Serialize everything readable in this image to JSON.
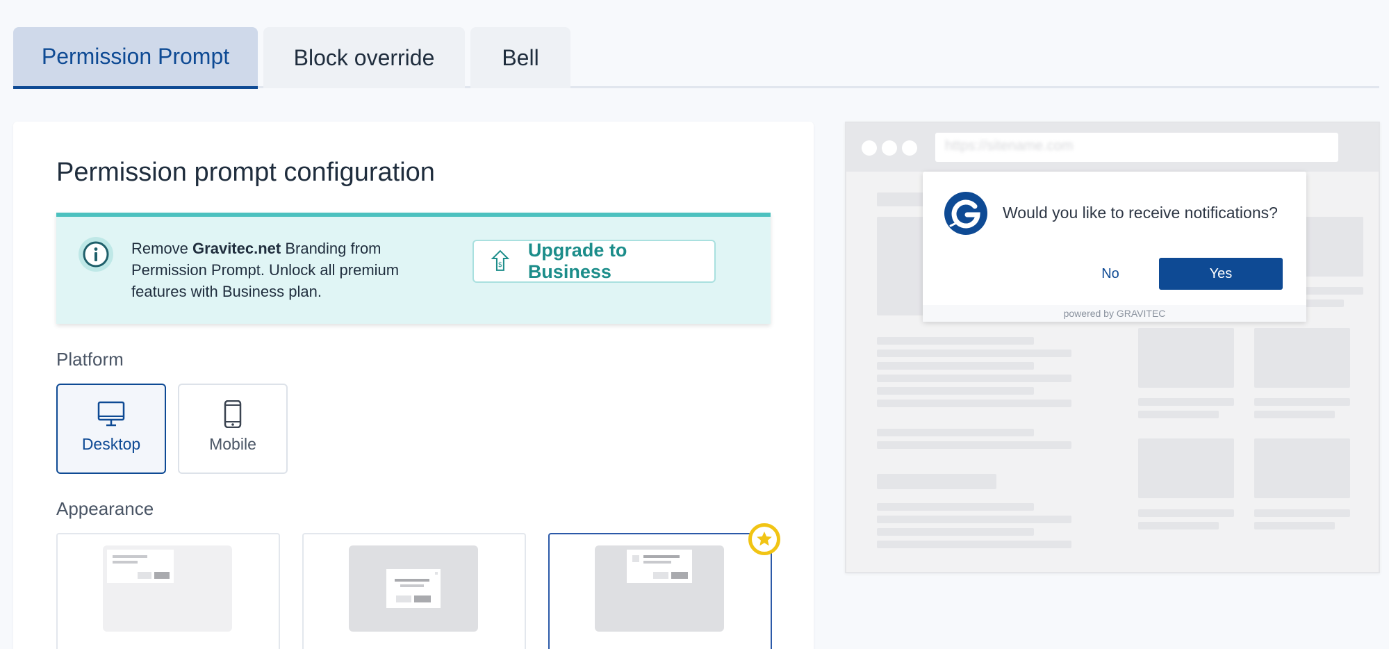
{
  "tabs": [
    {
      "label": "Permission Prompt",
      "active": true
    },
    {
      "label": "Block override",
      "active": false
    },
    {
      "label": "Bell",
      "active": false
    }
  ],
  "config": {
    "title": "Permission prompt configuration"
  },
  "banner": {
    "text_before": "Remove ",
    "brand": "Gravitec.net",
    "text_after": " Branding from Permission Prompt. Unlock all premium features with Business plan.",
    "button_label": "Upgrade to Business",
    "icon": "info-icon",
    "button_icon": "upgrade-arrow-icon"
  },
  "platform": {
    "label": "Platform",
    "options": [
      {
        "label": "Desktop",
        "icon": "desktop-icon",
        "selected": true
      },
      {
        "label": "Mobile",
        "icon": "mobile-icon",
        "selected": false
      }
    ]
  },
  "appearance": {
    "label": "Appearance",
    "selected_index": 2,
    "premium_badge_icon": "star-icon"
  },
  "preview": {
    "url_text": "https://sitename.com",
    "question": "Would you like to receive notifications?",
    "no_label": "No",
    "yes_label": "Yes",
    "powered_by": "powered by GRAVITEC",
    "logo_icon": "gravitec-logo-icon"
  },
  "colors": {
    "primary": "#0e4a94",
    "teal_accent": "#4cc1bf",
    "teal_text": "#1c8d8a",
    "banner_bg": "#e0f5f5",
    "star": "#f1c414"
  }
}
